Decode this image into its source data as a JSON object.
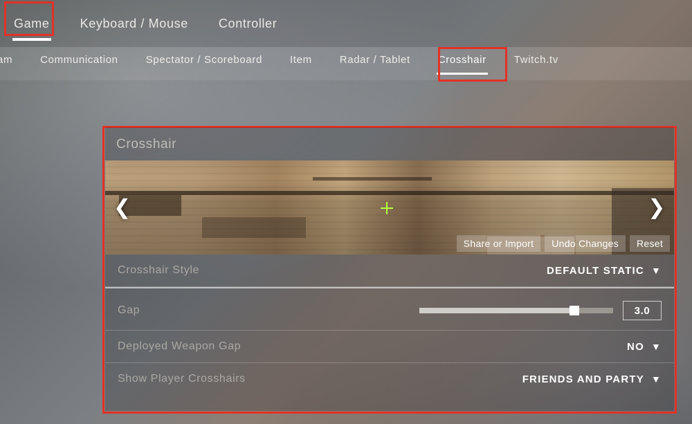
{
  "tabs1": [
    "Game",
    "Keyboard / Mouse",
    "Controller"
  ],
  "tabs1_active": 0,
  "tabs2": [
    "am",
    "Communication",
    "Spectator / Scoreboard",
    "Item",
    "Radar / Tablet",
    "Crosshair",
    "Twitch.tv"
  ],
  "tabs2_active": 5,
  "panel": {
    "title": "Crosshair",
    "actions": [
      "Share or Import",
      "Undo Changes",
      "Reset"
    ],
    "rows": {
      "style": {
        "label": "Crosshair Style",
        "value": "DEFAULT STATIC"
      },
      "gap": {
        "label": "Gap",
        "value": "3.0",
        "slider_pct": 80
      },
      "dwg": {
        "label": "Deployed Weapon Gap",
        "value": "NO"
      },
      "showp": {
        "label": "Show Player Crosshairs",
        "value": "FRIENDS AND PARTY"
      }
    }
  }
}
